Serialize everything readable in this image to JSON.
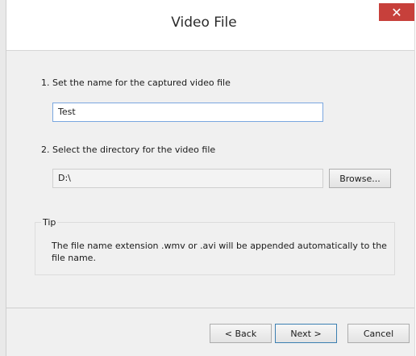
{
  "window": {
    "title": "Video File",
    "close_label": "✕"
  },
  "step1": {
    "label": "1. Set the name for the captured video file",
    "value": "Test"
  },
  "step2": {
    "label": "2. Select the directory for the video file",
    "value": "D:\\",
    "browse_label": "Browse..."
  },
  "tip": {
    "title": "Tip",
    "text": "The file name extension .wmv or .avi will be appended automatically to the file name."
  },
  "buttons": {
    "back": "< Back",
    "next": "Next >",
    "cancel": "Cancel"
  }
}
